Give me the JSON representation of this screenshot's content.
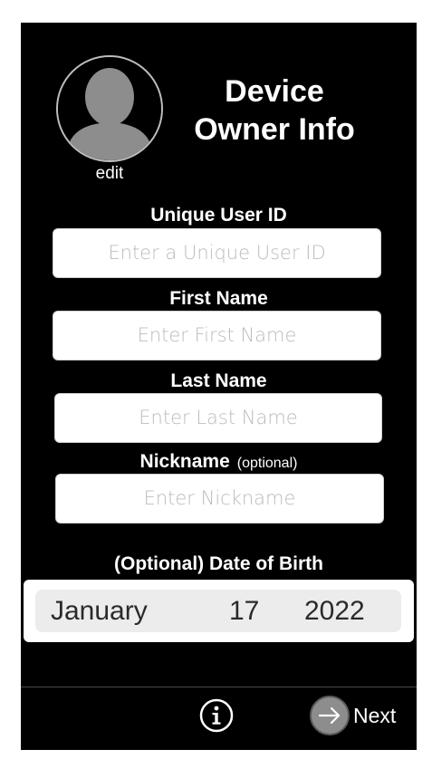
{
  "header": {
    "title_line1": "Device",
    "title_line2": "Owner Info",
    "edit_label": "edit"
  },
  "form": {
    "user_id": {
      "label": "Unique User ID",
      "placeholder": "Enter a Unique User ID",
      "value": ""
    },
    "first_name": {
      "label": "First Name",
      "placeholder": "Enter First Name",
      "value": ""
    },
    "last_name": {
      "label": "Last Name",
      "placeholder": "Enter Last Name",
      "value": ""
    },
    "nickname": {
      "label": "Nickname",
      "optional_tag": "(optional)",
      "placeholder": "Enter Nickname",
      "value": ""
    },
    "dob": {
      "label": "(Optional) Date of Birth",
      "month": "January",
      "day": "17",
      "year": "2022"
    }
  },
  "toolbar": {
    "info_icon": "info-circle-icon",
    "next_icon": "arrow-right-icon",
    "next_label": "Next"
  },
  "colors": {
    "background": "#000000",
    "text": "#ffffff",
    "placeholder": "#bcbcbc",
    "avatar": "#8d8d8d"
  }
}
